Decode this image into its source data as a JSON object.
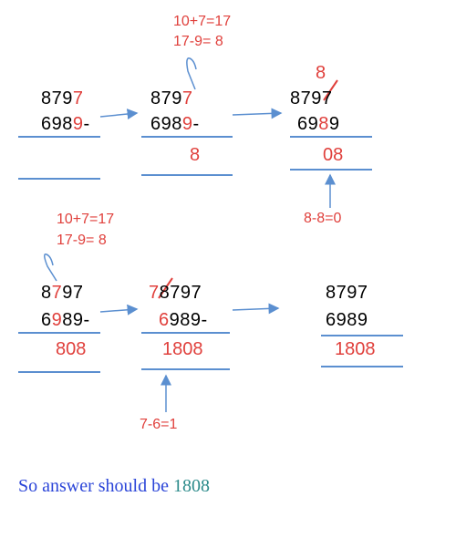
{
  "steps": [
    {
      "top_plain": "879",
      "top_red": "7",
      "bot_plain": "698",
      "bot_red": "9",
      "bot_suffix": "-",
      "result": ""
    },
    {
      "top_plain": "879",
      "top_red": "7",
      "bot_plain": "698",
      "bot_red": "9",
      "bot_suffix": "-",
      "result": "8"
    },
    {
      "borrow_digit": "8",
      "top_pre": "87",
      "top_struck": "9",
      "top_post": "7",
      "bot_pre": "69",
      "bot_red": "8",
      "bot_post": "9",
      "result": "08"
    },
    {
      "top_pre": "8",
      "top_red": "7",
      "top_post": "97",
      "bot_pre": "6",
      "bot_red": "9",
      "bot_post": "89-",
      "result": "808"
    },
    {
      "top_red": "7",
      "top_struck": "8",
      "top_post": "797",
      "bot_red": "6",
      "bot_post": "989-",
      "result": "1808"
    },
    {
      "top": "8797",
      "bottom": "6989",
      "result": "1808"
    }
  ],
  "notes": {
    "top_line1": "10+7=17",
    "top_line2": "17-9= 8",
    "mid_line1": "10+7=17",
    "mid_line2": "17-9= 8",
    "step3_note": "8-8=0",
    "step5_note": "7-6=1"
  },
  "footer": {
    "text": "So answer should be ",
    "answer": "1808"
  },
  "colors": {
    "accent_red": "#e0403c",
    "line_blue": "#5b8fd0",
    "footer_blue": "#2b45d8",
    "answer_teal": "#2b8a8a"
  }
}
